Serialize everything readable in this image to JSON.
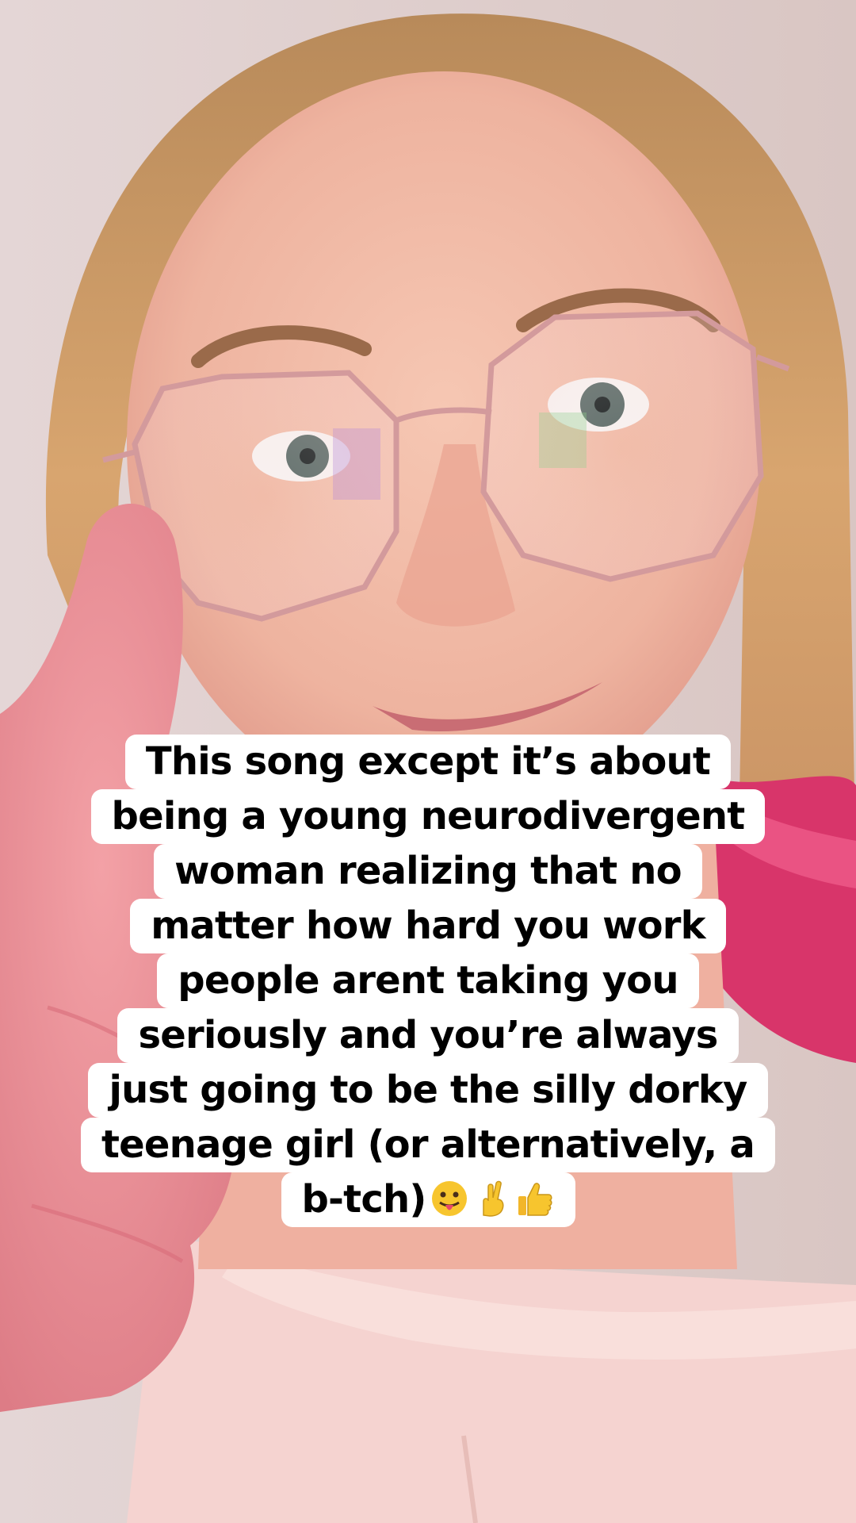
{
  "caption": {
    "lines": [
      "This song except it’s about",
      "being a young neurodivergent",
      "woman realizing that no",
      "matter how hard you work",
      "people arent taking you",
      "seriously and you’re always",
      "just going to be the silly dorky",
      "teenage girl (or alternatively, a",
      "b-tch)"
    ],
    "emojis": [
      "tongue-out-face",
      "crossed-fingers",
      "thumbs-up"
    ]
  },
  "colors": {
    "caption_background": "#ffffff",
    "caption_text": "#000000",
    "hair": "#d9a26b",
    "pink_hair": "#e0366f",
    "skin": "#f0b9a4",
    "glasses": "#c98a8f",
    "shirt": "#f6d3cf"
  }
}
